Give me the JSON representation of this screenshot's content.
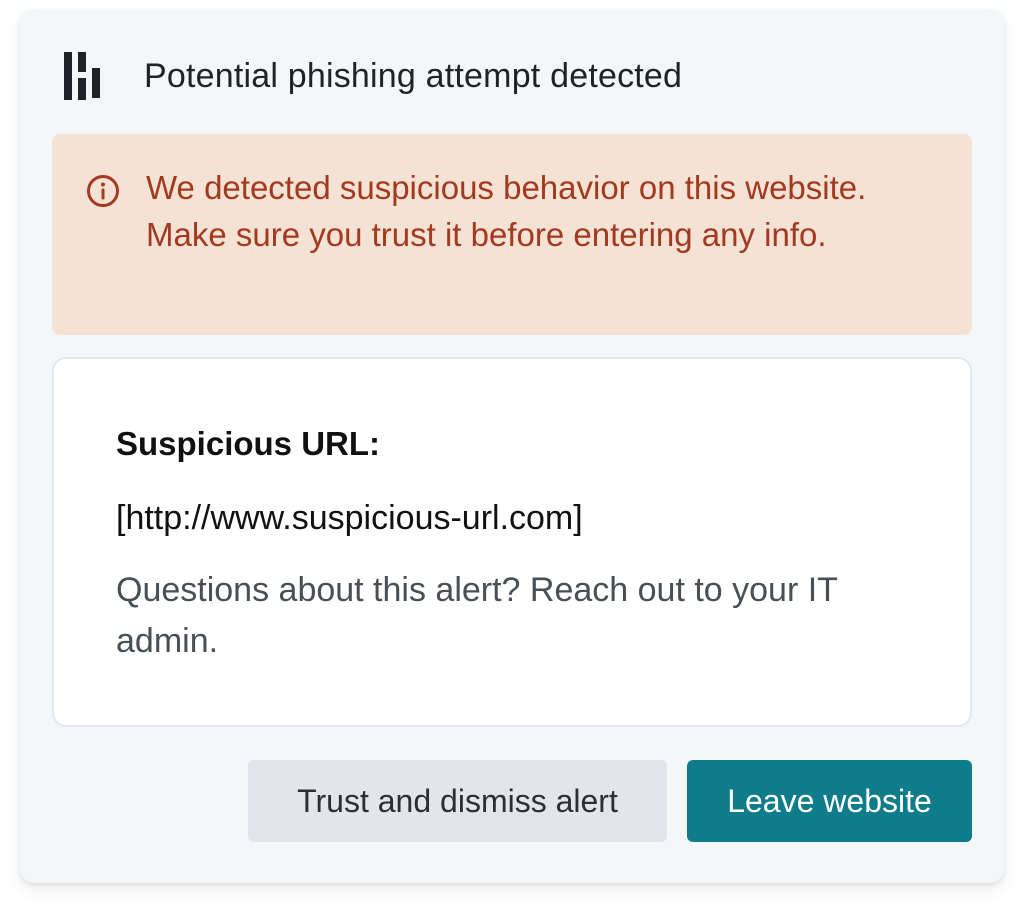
{
  "header": {
    "title": "Potential phishing attempt detected",
    "logo_icon": "brand-logo-icon"
  },
  "warning": {
    "icon": "info-circle-icon",
    "message": "We detected suspicious behavior on this website. Make sure you trust it before entering any info.",
    "background_color": "#f4e3d5",
    "text_color": "#a3391f"
  },
  "details": {
    "label": "Suspicious URL:",
    "url": "[http://www.suspicious-url.com]",
    "help_text": "Questions about this alert? Reach out to your IT admin."
  },
  "actions": {
    "trust_label": "Trust and dismiss alert",
    "leave_label": "Leave website",
    "primary_color": "#0e7c8a"
  }
}
